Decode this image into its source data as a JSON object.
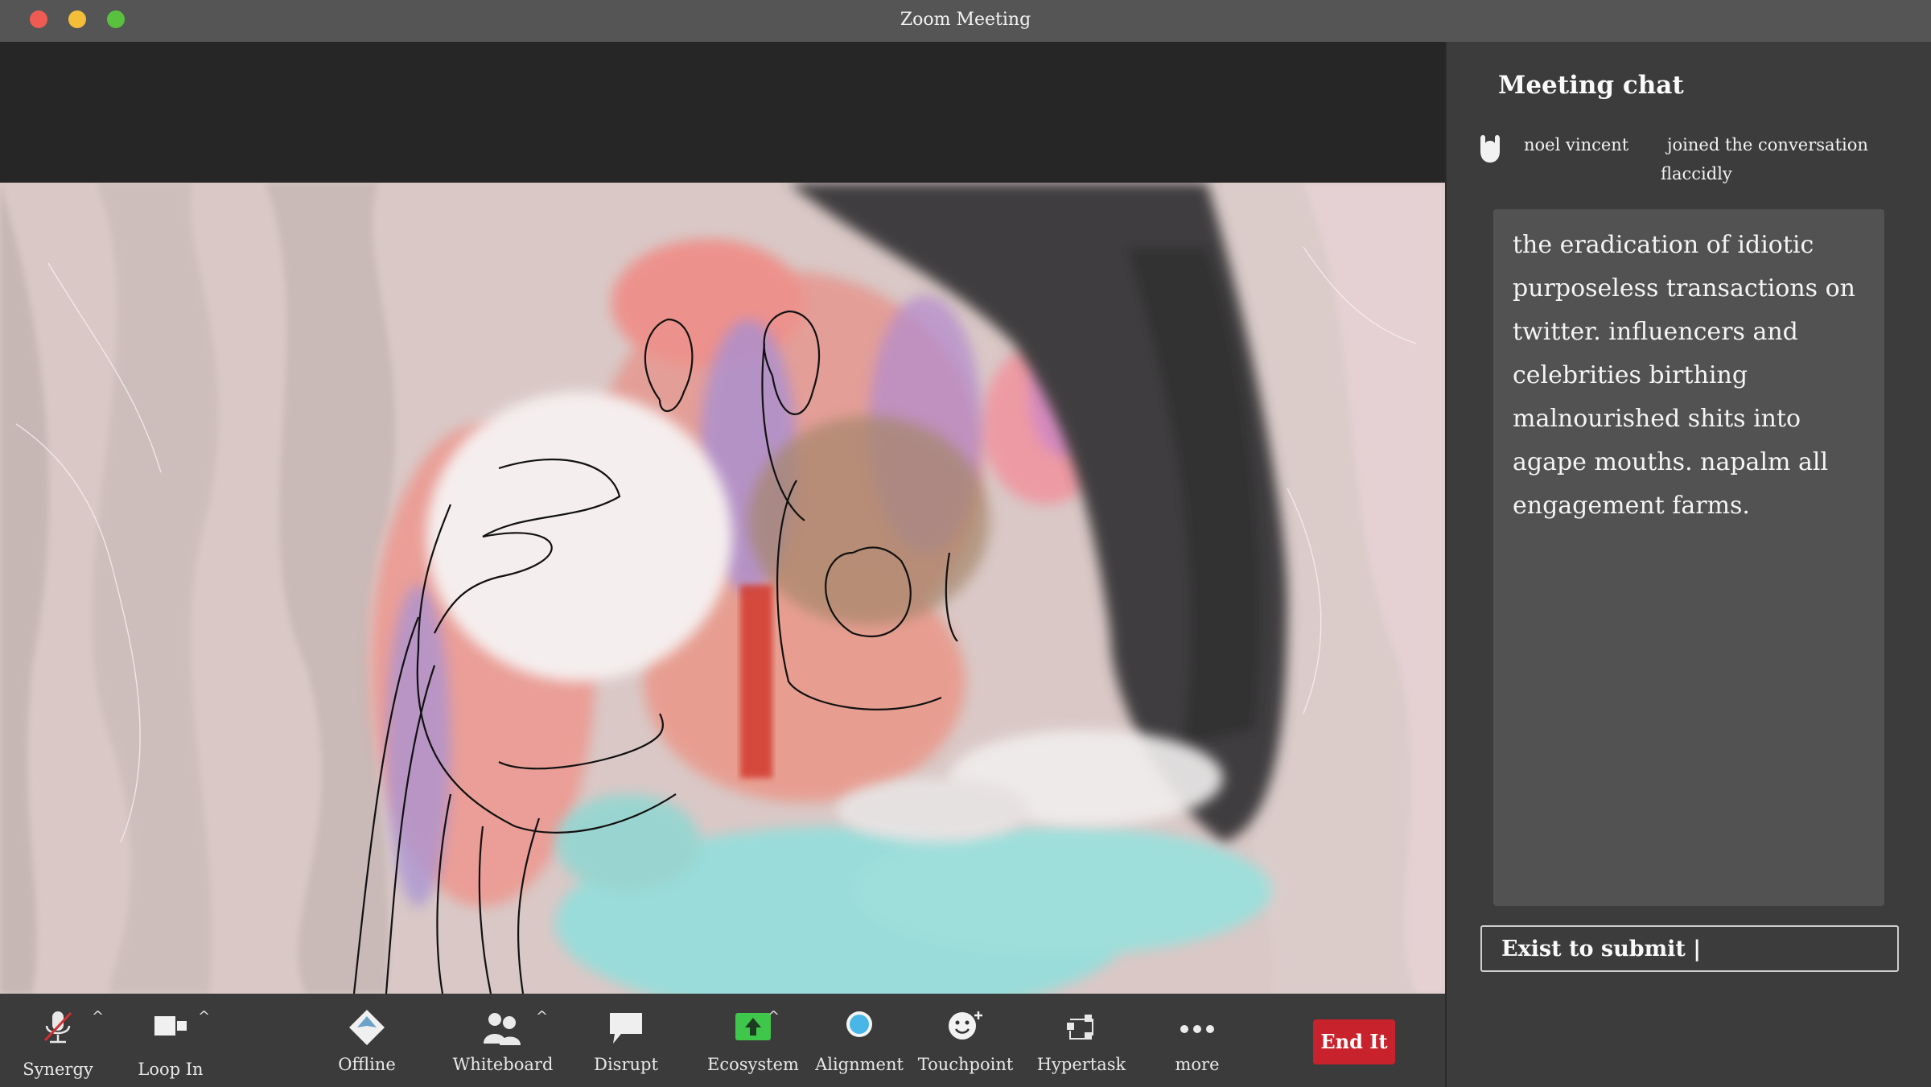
{
  "window": {
    "title": "Zoom Meeting"
  },
  "chat": {
    "title": "Meeting chat",
    "join": {
      "name": "noel vincent",
      "text": "joined the conversation",
      "adverb": "flaccidly"
    },
    "message": "the eradication of idiotic purposeless transactions on twitter. influencers and celebrities birthing malnourished shits into agape mouths. napalm all engagement farms.",
    "input_value": "Exist to submit |"
  },
  "toolbar": {
    "synergy": "Synergy",
    "loop_in": "Loop In",
    "offline": "Offline",
    "whiteboard": "Whiteboard",
    "disrupt": "Disrupt",
    "ecosystem": "Ecosystem",
    "alignment": "Alignment",
    "touchpoint": "Touchpoint",
    "hypertask": "Hypertask",
    "more": "more",
    "end": "End It",
    "caret": "^"
  },
  "colors": {
    "end_button": "#c8232c",
    "ecosystem_icon": "#3ec74a",
    "alignment_icon": "#49b6e8"
  }
}
